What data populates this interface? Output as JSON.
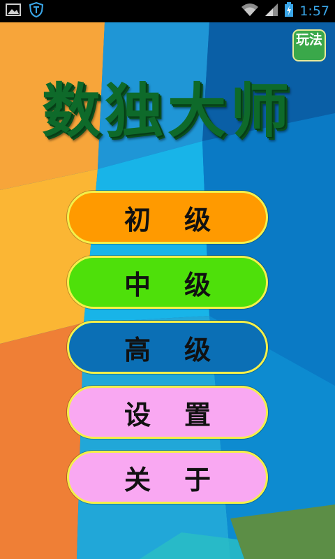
{
  "status_bar": {
    "time": "1:57",
    "left_icons": [
      "gallery-icon",
      "shield-icon"
    ],
    "right_icons": [
      "wifi-icon",
      "signal-icon",
      "battery-charging-icon"
    ],
    "accent_color": "#3aa6e8"
  },
  "header": {
    "title": "数独大师",
    "title_color": "#0e6a2a",
    "rules_button_label": "玩法"
  },
  "menu": {
    "items": [
      {
        "label": "初级",
        "color": "#ff9a00"
      },
      {
        "label": "中级",
        "color": "#4ee00a"
      },
      {
        "label": "高级",
        "color": "#0b6fb5"
      },
      {
        "label": "设置",
        "color": "#f9a8f2"
      },
      {
        "label": "关于",
        "color": "#f9a8f2"
      }
    ],
    "border_color": "#f4f04a"
  }
}
